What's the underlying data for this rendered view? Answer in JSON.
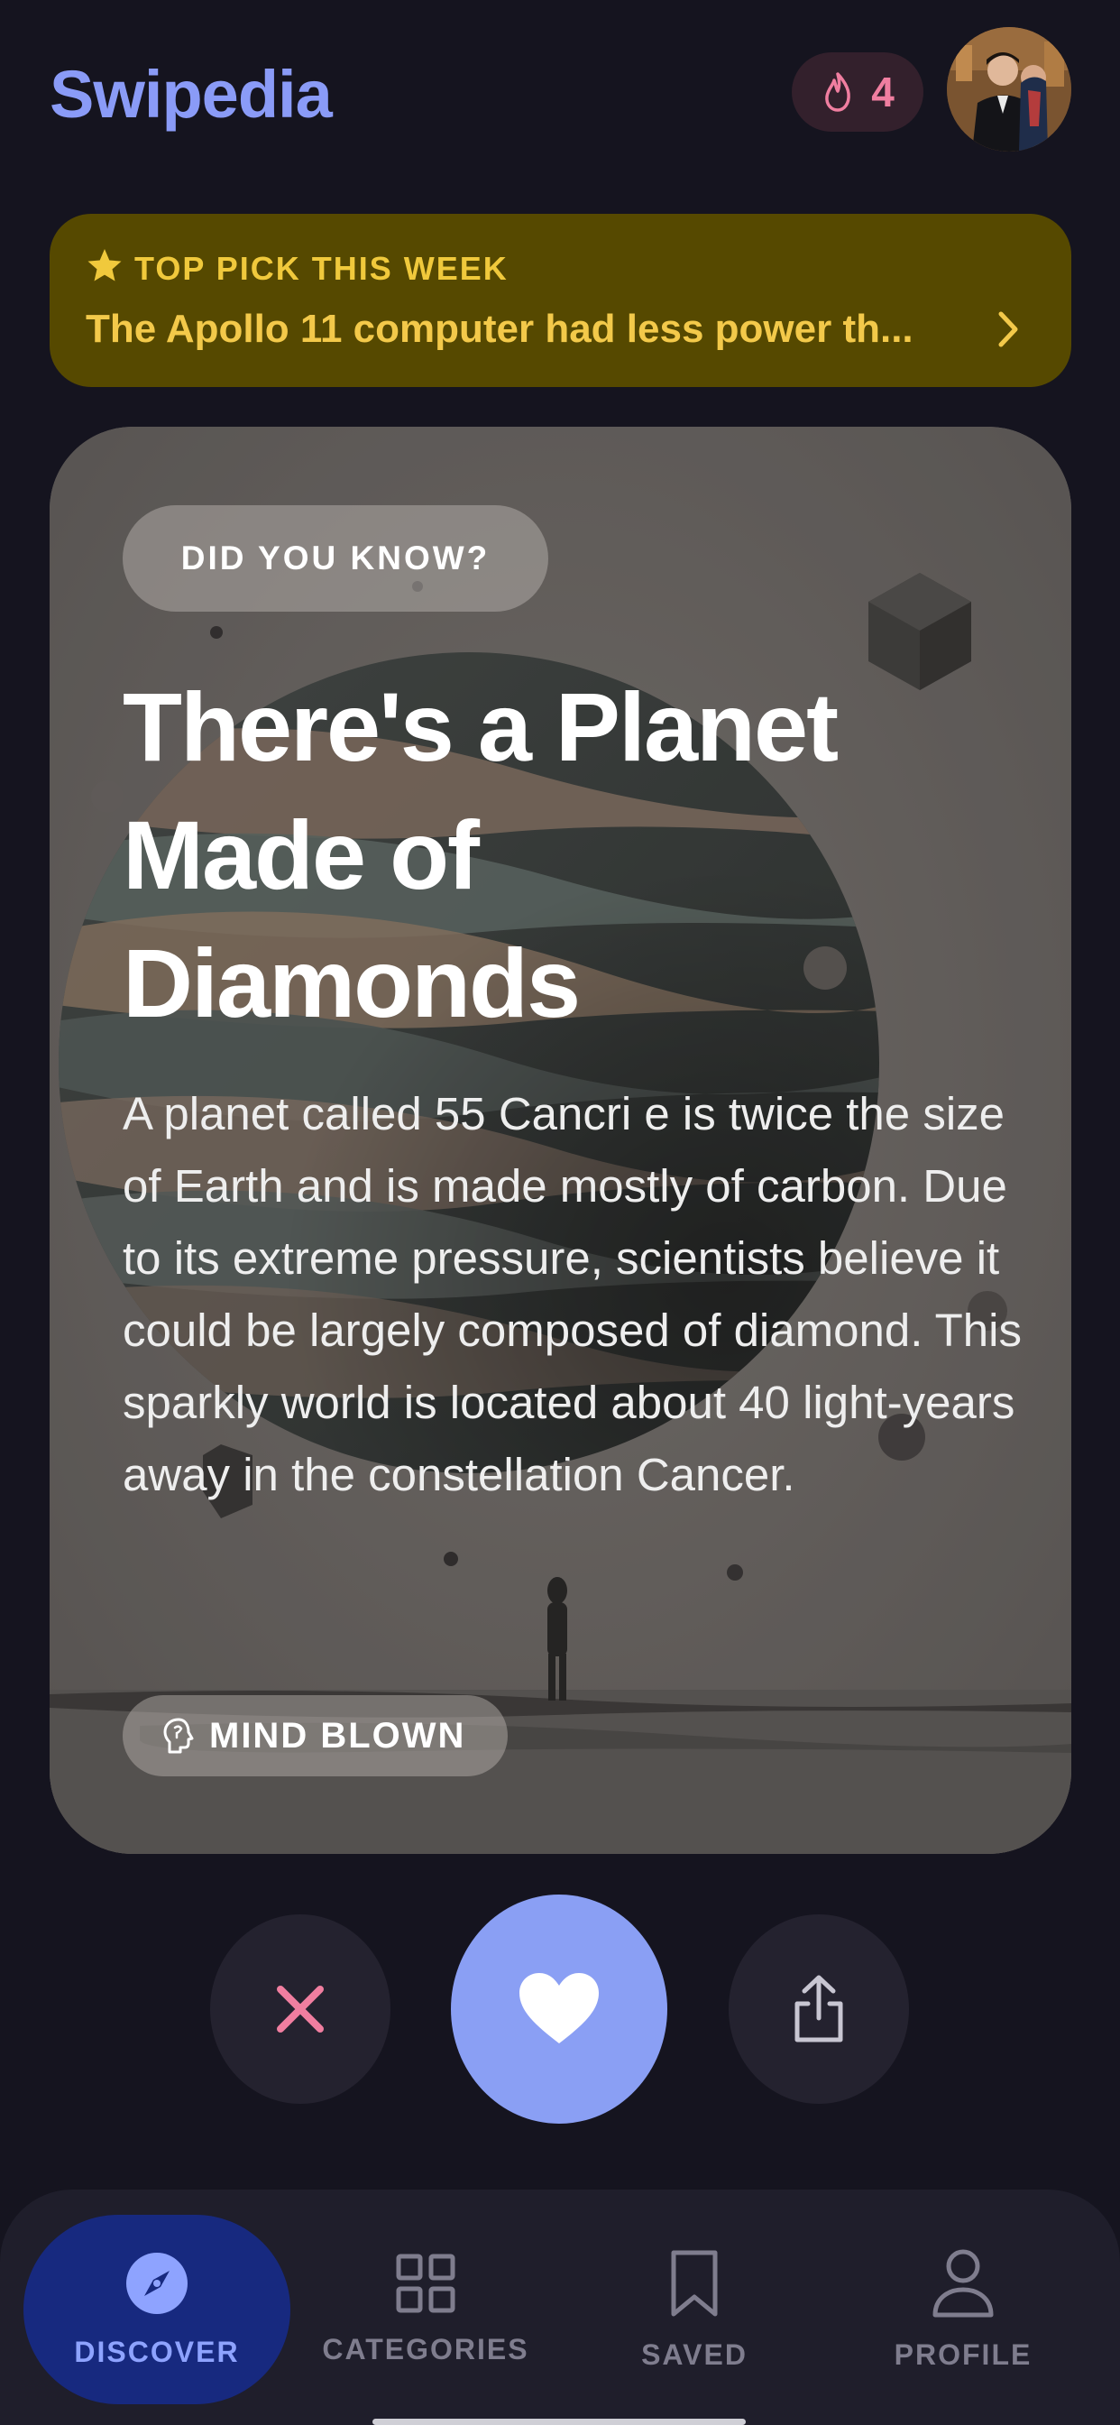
{
  "app": {
    "title": "Swipedia"
  },
  "header": {
    "streak_count": "4",
    "streak_icon": "flame-icon",
    "avatar_icon": "user-photo"
  },
  "top_pick": {
    "label": "TOP PICK THIS WEEK",
    "text": "The Apollo 11 computer had less power th...",
    "icon": "star-icon"
  },
  "card": {
    "badge": "DID YOU KNOW?",
    "title": "There's a Planet Made of Diamonds",
    "body": "A planet called 55 Cancri e is twice the size of Earth and is made mostly of carbon. Due to its extreme pressure, scientists believe it could be largely composed of diamond. This sparkly world is located about 40 light-years away in the constellation Cancer.",
    "reaction_label": "MIND BLOWN",
    "reaction_icon": "brain-icon"
  },
  "actions": {
    "skip_icon": "close-icon",
    "like_icon": "heart-icon",
    "share_icon": "share-icon"
  },
  "nav": {
    "items": [
      {
        "label": "DISCOVER",
        "icon": "compass-icon",
        "active": true
      },
      {
        "label": "CATEGORIES",
        "icon": "grid-icon",
        "active": false
      },
      {
        "label": "SAVED",
        "icon": "bookmark-icon",
        "active": false
      },
      {
        "label": "PROFILE",
        "icon": "person-icon",
        "active": false
      }
    ]
  },
  "colors": {
    "background": "#15141f",
    "brand": "#8a9bf7",
    "accent_gold": "#f0c93c",
    "streak_pink": "#f07ea0",
    "like_button": "#8a9ff4",
    "nav_active_bg": "#17297f"
  }
}
